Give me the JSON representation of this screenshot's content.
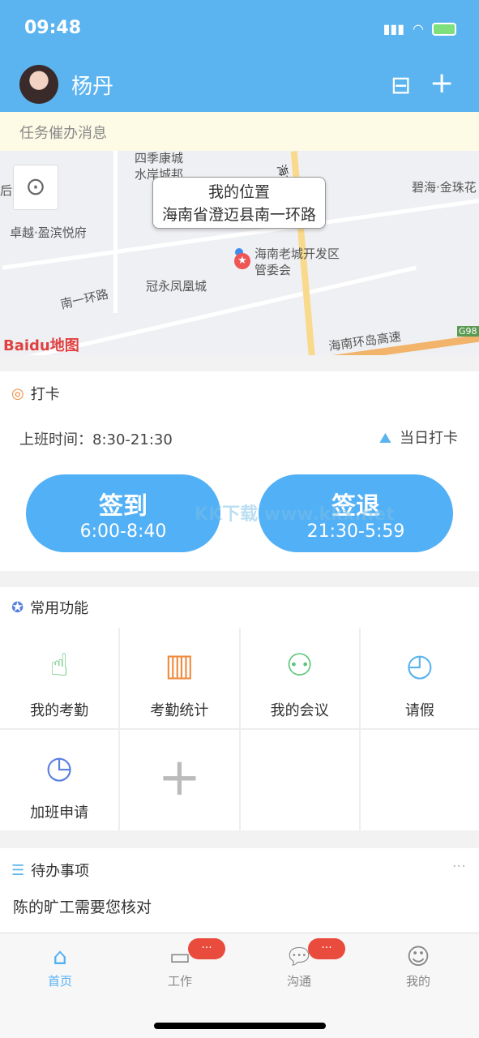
{
  "status": {
    "time": "09:48"
  },
  "header": {
    "username": "杨丹"
  },
  "notice": "任务催办消息",
  "map": {
    "bubble_title": "我的位置",
    "bubble_address": "海南省澄迈县南一环路",
    "labels": [
      "四季康城",
      "水岸城邦",
      "后海小镇",
      "卓越·盈滨悦府",
      "冠永凤凰城",
      "南一环路",
      "海南老城开发区",
      "管委会",
      "碧海·金珠花",
      "海南环岛高速",
      "G98",
      "海大道"
    ],
    "logo": "Baidu地图"
  },
  "checkin": {
    "title": "打卡",
    "work_time": "上班时间：8:30-21:30",
    "daily": "当日打卡",
    "sign_in": {
      "label": "签到",
      "time": "6:00-8:40"
    },
    "sign_out": {
      "label": "签退",
      "time": "21:30-5:59"
    }
  },
  "watermark": "KK下载 www.kkx.net",
  "functions": {
    "title": "常用功能",
    "items": [
      {
        "label": "我的考勤",
        "icon": "hand-tap-icon"
      },
      {
        "label": "考勤统计",
        "icon": "bar-chart-icon"
      },
      {
        "label": "我的会议",
        "icon": "meeting-icon"
      },
      {
        "label": "请假",
        "icon": "leave-icon"
      },
      {
        "label": "加班申请",
        "icon": "overtime-clock-icon"
      }
    ]
  },
  "todo": {
    "title": "待办事项",
    "item": "陈的旷工需要您核对"
  },
  "tabbar": {
    "items": [
      "首页",
      "工作",
      "沟通",
      "我的"
    ],
    "badge": "···",
    "active_color": "#52b0f6"
  }
}
